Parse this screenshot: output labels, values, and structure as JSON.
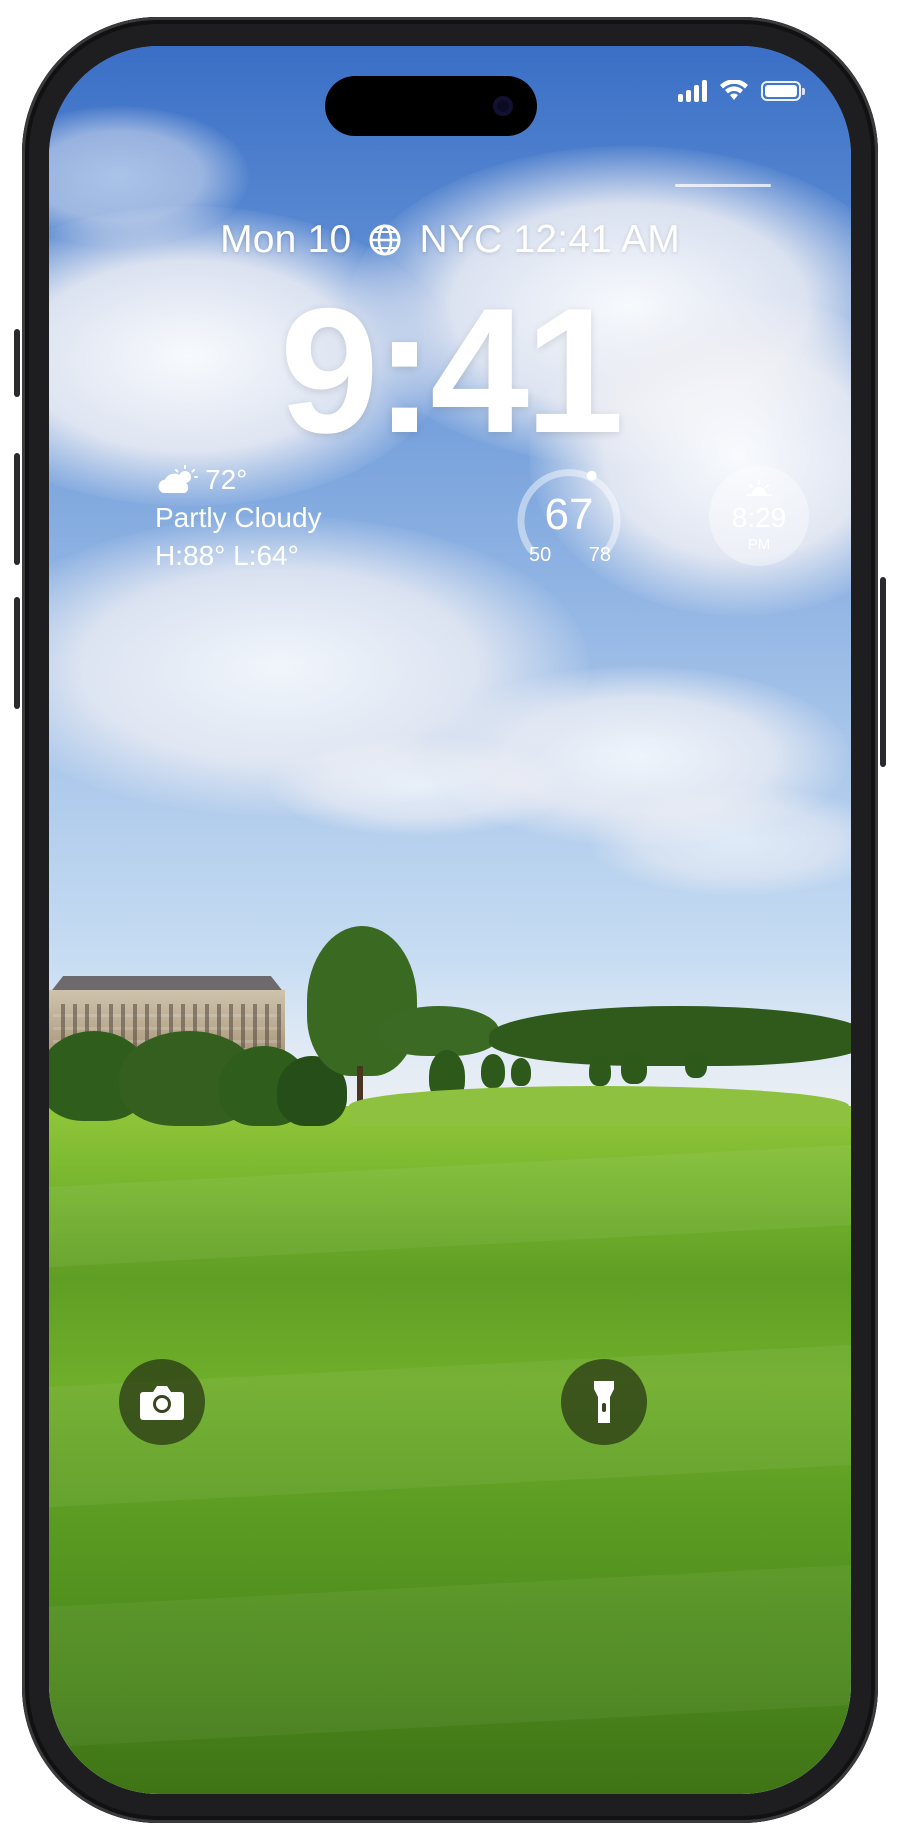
{
  "lock_screen": {
    "date": "Mon 10",
    "world_clock_city": "NYC",
    "world_clock_time": "12:41 AM",
    "time": "9:41"
  },
  "weather": {
    "icon": "partly-cloudy-icon",
    "temperature": "72°",
    "condition": "Partly Cloudy",
    "high_low": "H:88° L:64°"
  },
  "temperature_gauge": {
    "current": "67",
    "min": "50",
    "max": "78",
    "level": 0.61
  },
  "sunset": {
    "icon": "sunset-icon",
    "time": "8:29",
    "meridiem": "PM"
  },
  "quick_actions": {
    "camera_icon": "camera-icon",
    "flashlight_icon": "flashlight-icon"
  },
  "colors": {
    "frame": "#1e1e20",
    "text": "#ffffff",
    "action_button": "#37461e"
  }
}
